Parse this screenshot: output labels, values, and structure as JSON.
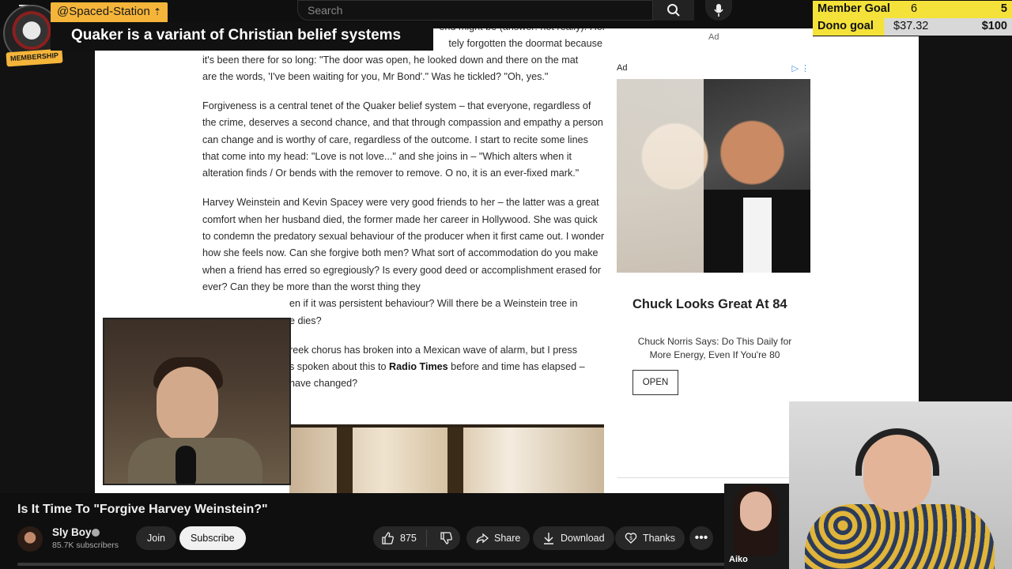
{
  "search": {
    "placeholder": "Search"
  },
  "overlay": {
    "handle": "@Spaced-Station",
    "headline": "Quaker is a variant of Christian belief systems",
    "membership": "MEMBERSHIP"
  },
  "goals": [
    {
      "label": "Member Goal",
      "current": "6",
      "target": "5"
    },
    {
      "label": "Dono goal",
      "current": "$37.32",
      "target": "$100"
    }
  ],
  "article": {
    "p1_tail": "...tely forgotten the doormat because it's been there for so long: \"The door was open, he looked down and there on the mat are the words, 'I've been waiting for you, Mr Bond'.\" Was he tickled? \"Oh, yes.\"",
    "p1_top": "end might be (answer: not really). Her",
    "p1_l2": "tely forgotten the doormat because",
    "p1_l3": "it's been there for so long: \"The door was open, he looked down and there on the mat",
    "p1_l4": "are the words, 'I've been waiting for you, Mr Bond'.\" Was he tickled? \"Oh, yes.\"",
    "p2": "Forgiveness is a central tenet of the Quaker belief system – that everyone, regardless of the crime, deserves a second chance, and that through compassion and empathy a person can change and is worthy of care, regardless of the outcome. I start to recite some lines that come into my head: \"Love is not love...\" and she joins in – \"Which alters when it alteration finds / Or bends with the remover to remove. O no, it is an ever-fixed mark.\"",
    "p3": "Harvey Weinstein and Kevin Spacey were very good friends to her – the latter was a great comfort when her husband died, the former made her career in Hollywood. She was quick to condemn the predatory sexual behaviour of the producer when it first came out. I wonder how she feels now. Can she forgive both men? What sort of accommodation do you make when a friend has erred so egregiously? Is every good deed or accomplishment erased for ever? Can they be more than the worst thing they",
    "p3_tail1": "en if it was persistent behaviour? Will there be a Weinstein tree in",
    "p3_tail2": "e dies?",
    "p4_l1": "reek chorus has broken into a Mexican wave of alarm, but I press",
    "p4_l2a": "s spoken about this to ",
    "p4_l2b": "Radio Times",
    "p4_l2c": " before and time has elapsed –",
    "p4_l3": "have changed?"
  },
  "ad": {
    "label_top": "Ad",
    "label": "Ad",
    "headline": "Chuck Looks Great At 84",
    "sub": "Chuck Norris Says: Do This Daily for More Energy, Even If You're 80",
    "cta": "OPEN"
  },
  "video": {
    "title": "Is It Time To \"Forgive Harvey Weinstein?\"",
    "channel": "Sly Boy",
    "subscribers": "85.7K subscribers",
    "join": "Join",
    "subscribe": "Subscribe",
    "likes": "875",
    "share": "Share",
    "download": "Download",
    "thanks": "Thanks"
  },
  "guest_name": "Aiko",
  "icons": {
    "search": "search-icon",
    "mic": "mic-icon",
    "like": "thumbs-up-icon",
    "dislike": "thumbs-down-icon",
    "share": "share-arrow-icon",
    "download": "download-icon",
    "thanks": "thanks-heart-icon",
    "more": "more-horizontal-icon"
  },
  "colors": {
    "accent": "#f5b53a",
    "goal": "#f4e23a",
    "yt_bg": "#0f0f0f"
  }
}
